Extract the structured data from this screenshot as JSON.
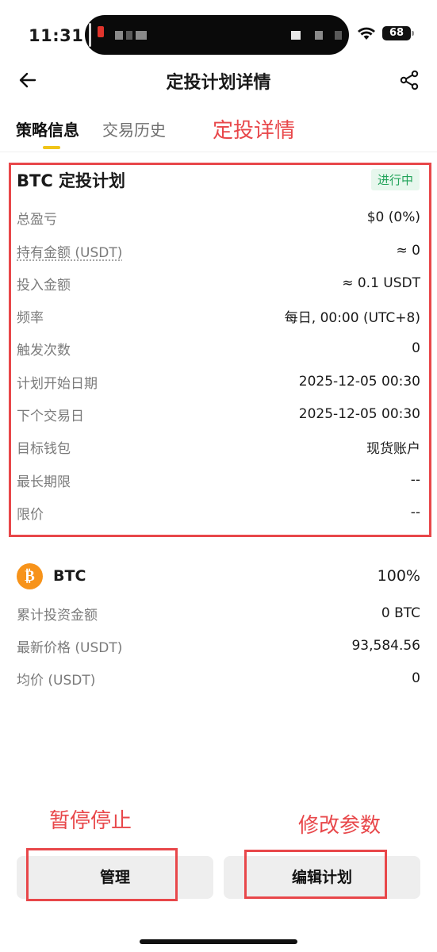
{
  "status_bar": {
    "time": "11:31",
    "battery": "68"
  },
  "header": {
    "title": "定投计划详情"
  },
  "tabs": [
    {
      "label": "策略信息",
      "active": true
    },
    {
      "label": "交易历史",
      "active": false
    }
  ],
  "annotations": {
    "detail": "定投详情",
    "pause_stop": "暂停停止",
    "edit_params": "修改参数"
  },
  "plan": {
    "title": "BTC 定投计划",
    "status": "进行中",
    "rows": [
      {
        "label": "总盈亏",
        "value": "$0 (0%)"
      },
      {
        "label": "持有金额 (USDT)",
        "value": "≈ 0"
      },
      {
        "label": "投入金额",
        "value": "≈ 0.1 USDT"
      },
      {
        "label": "频率",
        "value": "每日, 00:00 (UTC+8)"
      },
      {
        "label": "触发次数",
        "value": "0"
      },
      {
        "label": "计划开始日期",
        "value": "2025-12-05 00:30"
      },
      {
        "label": "下个交易日",
        "value": "2025-12-05 00:30"
      },
      {
        "label": "目标钱包",
        "value": "现货账户"
      },
      {
        "label": "最长期限",
        "value": "--"
      },
      {
        "label": "限价",
        "value": "--"
      }
    ]
  },
  "asset": {
    "icon_glyph": "₿",
    "name": "BTC",
    "percent": "100%",
    "rows": [
      {
        "label": "累计投资金额",
        "value": "0 BTC"
      },
      {
        "label": "最新价格 (USDT)",
        "value": "93,584.56"
      },
      {
        "label": "均价 (USDT)",
        "value": "0"
      }
    ]
  },
  "buttons": {
    "manage": "管理",
    "edit_plan": "编辑计划"
  },
  "colors": {
    "accent_yellow": "#f0c419",
    "annotation_red": "#e8474a",
    "status_green": "#22a35a",
    "btc_orange": "#f7931a"
  },
  "icons": {
    "back": "arrow-left-icon",
    "share": "share-icon",
    "wifi": "wifi-icon",
    "battery": "battery-icon",
    "btc": "bitcoin-icon"
  }
}
